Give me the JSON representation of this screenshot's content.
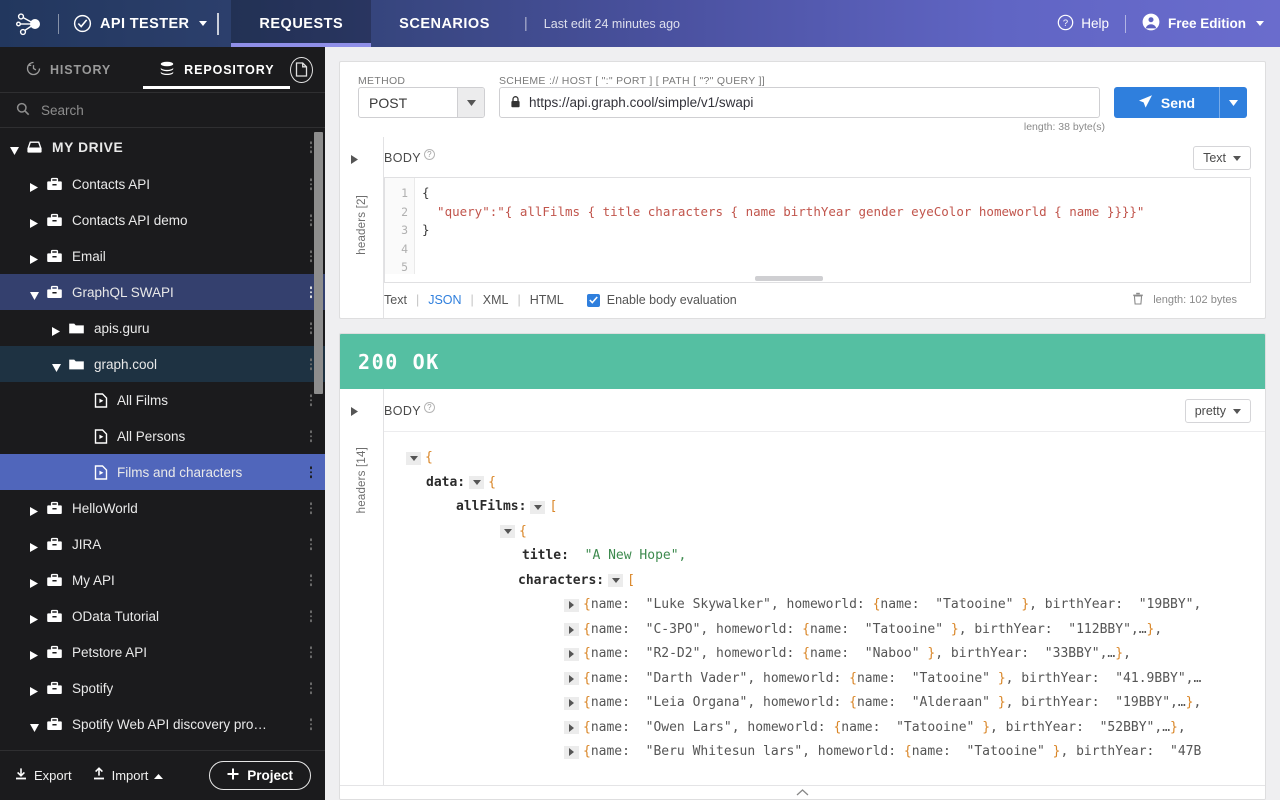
{
  "topbar": {
    "logo_icon": "node-graph-logo",
    "app_name": "API TESTER",
    "app_caret_icon": "chevron-down-icon",
    "app_check_icon": "check-circle-icon",
    "tabs": [
      {
        "label": "REQUESTS",
        "active": true
      },
      {
        "label": "SCENARIOS",
        "active": false
      }
    ],
    "separator": "|",
    "last_edit": "Last edit 24 minutes ago",
    "help_label": "Help",
    "help_icon": "question-circle-icon",
    "user_label": "Free Edition",
    "user_icon": "user-circle-icon",
    "user_caret_icon": "chevron-down-icon"
  },
  "sidebar": {
    "tabs": [
      {
        "label": "HISTORY",
        "icon": "clock-icon",
        "active": false
      },
      {
        "label": "REPOSITORY",
        "icon": "database-icon",
        "active": true
      }
    ],
    "doc_button_icon": "document-icon",
    "search": {
      "placeholder": "Search",
      "icon": "search-icon",
      "value": ""
    },
    "tree": [
      {
        "label": "MY DRIVE",
        "level": 0,
        "icon": "drive-icon",
        "twisty": "down",
        "state": "root",
        "menu": true
      },
      {
        "label": "Contacts API",
        "level": 1,
        "icon": "project-icon",
        "twisty": "right",
        "state": "normal",
        "menu": true
      },
      {
        "label": "Contacts API demo",
        "level": 1,
        "icon": "project-icon",
        "twisty": "right",
        "state": "normal",
        "menu": true
      },
      {
        "label": "Email",
        "level": 1,
        "icon": "project-icon",
        "twisty": "right",
        "state": "normal",
        "menu": true
      },
      {
        "label": "GraphQL SWAPI",
        "level": 1,
        "icon": "project-icon",
        "twisty": "down",
        "state": "sel-mid",
        "menu": true
      },
      {
        "label": "apis.guru",
        "level": 2,
        "icon": "folder-icon",
        "twisty": "right",
        "state": "normal",
        "menu": true
      },
      {
        "label": "graph.cool",
        "level": 2,
        "icon": "folder-icon",
        "twisty": "down",
        "state": "sel-dark",
        "menu": true
      },
      {
        "label": "All Films",
        "level": 3,
        "icon": "request-icon",
        "twisty": "none",
        "state": "normal",
        "menu": true
      },
      {
        "label": "All Persons",
        "level": 3,
        "icon": "request-icon",
        "twisty": "none",
        "state": "normal",
        "menu": true
      },
      {
        "label": "Films and characters",
        "level": 3,
        "icon": "request-icon",
        "twisty": "none",
        "state": "sel-bright",
        "menu": true
      },
      {
        "label": "HelloWorld",
        "level": 1,
        "icon": "project-icon",
        "twisty": "right",
        "state": "normal",
        "menu": true
      },
      {
        "label": "JIRA",
        "level": 1,
        "icon": "project-icon",
        "twisty": "right",
        "state": "normal",
        "menu": true
      },
      {
        "label": "My API",
        "level": 1,
        "icon": "project-icon",
        "twisty": "right",
        "state": "normal",
        "menu": true
      },
      {
        "label": "OData Tutorial",
        "level": 1,
        "icon": "project-icon",
        "twisty": "right",
        "state": "normal",
        "menu": true
      },
      {
        "label": "Petstore API",
        "level": 1,
        "icon": "project-icon",
        "twisty": "right",
        "state": "normal",
        "menu": true
      },
      {
        "label": "Spotify",
        "level": 1,
        "icon": "project-icon",
        "twisty": "right",
        "state": "normal",
        "menu": true
      },
      {
        "label": "Spotify Web API discovery pro…",
        "level": 1,
        "icon": "project-icon",
        "twisty": "down",
        "state": "normal",
        "menu": true
      }
    ],
    "footer": {
      "export_label": "Export",
      "export_icon": "download-icon",
      "import_label": "Import",
      "import_icon": "upload-icon",
      "import_caret_icon": "chevron-up-icon",
      "project_label": "Project",
      "project_icon": "plus-icon"
    }
  },
  "request": {
    "method_label": "METHOD",
    "method_value": "POST",
    "url_label": "SCHEME :// HOST [ \":\" PORT ] [ PATH [ \"?\" QUERY ]]",
    "url_value": "https://api.graph.cool/simple/v1/swapi",
    "url_lock_icon": "lock-icon",
    "send_label": "Send",
    "send_icon": "paper-plane-icon",
    "url_length": "length: 38 byte(s)",
    "headers_label": "headers [2]",
    "headers_toggle_icon": "triangle-right-icon",
    "body_label": "BODY",
    "body_help_icon": "question-icon",
    "format_selected": "Text",
    "format_caret_icon": "chevron-down-icon",
    "line_numbers": [
      "1",
      "2",
      "3",
      "4",
      "5"
    ],
    "code_lines": [
      "{",
      "  \"query\":\"{ allFilms { title characters { name birthYear gender eyeColor homeworld { name }}}}\"",
      "}",
      "",
      ""
    ],
    "format_options": [
      "Text",
      "JSON",
      "XML",
      "HTML"
    ],
    "format_active": "JSON",
    "eval_label": "Enable body evaluation",
    "eval_checked": true,
    "delete_icon": "trash-icon",
    "body_length": "length: 102 bytes"
  },
  "response": {
    "status": "200 OK",
    "status_color": "#55bfa2",
    "headers_label": "headers [14]",
    "headers_toggle_icon": "triangle-right-icon",
    "body_label": "BODY",
    "body_help_icon": "question-icon",
    "view_selected": "pretty",
    "view_caret_icon": "chevron-down-icon",
    "collapse_icon": "chevron-up-icon",
    "json": {
      "root_open": "{",
      "data_key": "data:",
      "data_open": "{",
      "allfilms_key": "allFilms:",
      "allfilms_open": "[",
      "film_open": "{",
      "title_key": "title:",
      "title_value": "\"A New Hope\",",
      "characters_key": "characters:",
      "characters_open": "[",
      "characters": [
        "{name:  \"Luke Skywalker\", homeworld: {name:  \"Tatooine\" }, birthYear:  \"19BBY\",",
        "{name:  \"C-3PO\", homeworld: {name:  \"Tatooine\" }, birthYear:  \"112BBY\",…},",
        "{name:  \"R2-D2\", homeworld: {name:  \"Naboo\" }, birthYear:  \"33BBY\",…},",
        "{name:  \"Darth Vader\", homeworld: {name:  \"Tatooine\" }, birthYear:  \"41.9BBY\",…",
        "{name:  \"Leia Organa\", homeworld: {name:  \"Alderaan\" }, birthYear:  \"19BBY\",…},",
        "{name:  \"Owen Lars\", homeworld: {name:  \"Tatooine\" }, birthYear:  \"52BBY\",…},",
        "{name:  \"Beru Whitesun lars\", homeworld: {name:  \"Tatooine\" }, birthYear:  \"47B"
      ]
    }
  }
}
